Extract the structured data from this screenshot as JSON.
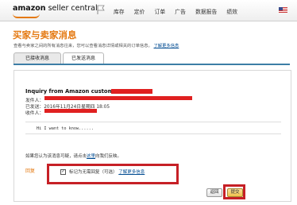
{
  "header": {
    "logo_main": "amazon",
    "logo_sub": "seller central",
    "nav": [
      "库存",
      "定价",
      "订单",
      "广告",
      "数据报告",
      "绩效"
    ]
  },
  "page": {
    "title": "买家与卖家消息",
    "subtitle": "查看与卖家之间的所有消息往来，您可以查看消息详情或相关的订单信息。",
    "subtitle_link": "了解更多信息"
  },
  "tabs": [
    {
      "label": "已接收消息"
    },
    {
      "label": "已发送消息"
    }
  ],
  "message": {
    "subject": "Inquiry from Amazon customer",
    "from_label": "发件人：",
    "sent_label": "已发送：",
    "sent_value": "2016年11月24日星期四 18:05",
    "to_label": "收件人：",
    "body": "Hi I want to know......"
  },
  "report": {
    "text_before": "如果您认为该消息可疑，请点击",
    "link": "这里",
    "text_after": "向我们反映。"
  },
  "reply": {
    "label": "回复",
    "checkbox_label": "标记为无需回复（可选）",
    "learn_more": "了解更多信息",
    "checkbox_mark": "✓"
  },
  "buttons": {
    "back": "返回",
    "submit": "提交"
  }
}
